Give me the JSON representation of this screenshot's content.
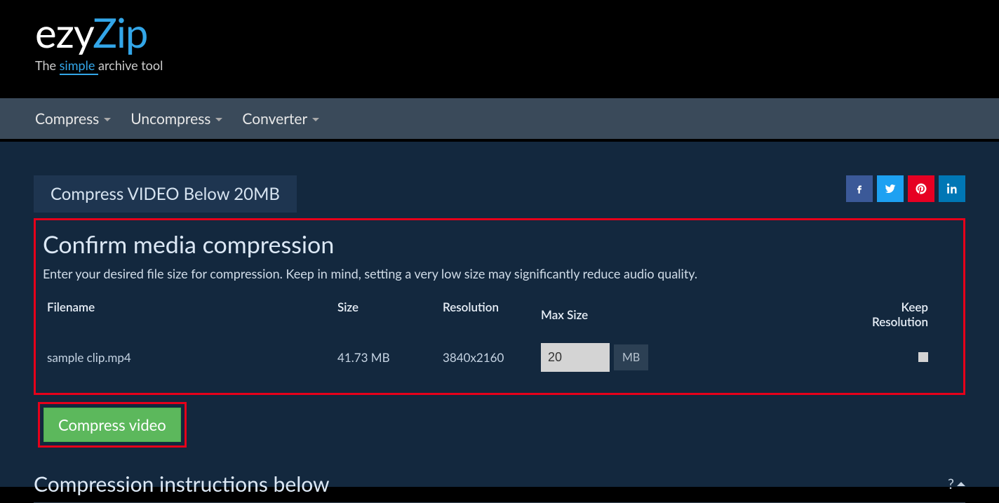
{
  "logo": {
    "part1": "ezy",
    "part2": "Zip",
    "tagline_pre": "The ",
    "tagline_simple": "simple ",
    "tagline_post": "archive tool"
  },
  "nav": {
    "items": [
      "Compress",
      "Uncompress",
      "Converter"
    ]
  },
  "tab": {
    "label": "Compress VIDEO Below 20MB"
  },
  "section": {
    "title": "Confirm media compression",
    "desc": "Enter your desired file size for compression. Keep in mind, setting a very low size may significantly reduce audio quality."
  },
  "table": {
    "headers": {
      "filename": "Filename",
      "size": "Size",
      "resolution": "Resolution",
      "maxsize": "Max Size",
      "keepres": "Keep Resolution"
    },
    "row": {
      "filename": "sample clip.mp4",
      "size": "41.73 MB",
      "resolution": "3840x2160",
      "maxsize_value": "20",
      "maxsize_unit": "MB"
    }
  },
  "buttons": {
    "compress": "Compress video"
  },
  "instructions": {
    "title": "Compression instructions below",
    "help": "?"
  }
}
